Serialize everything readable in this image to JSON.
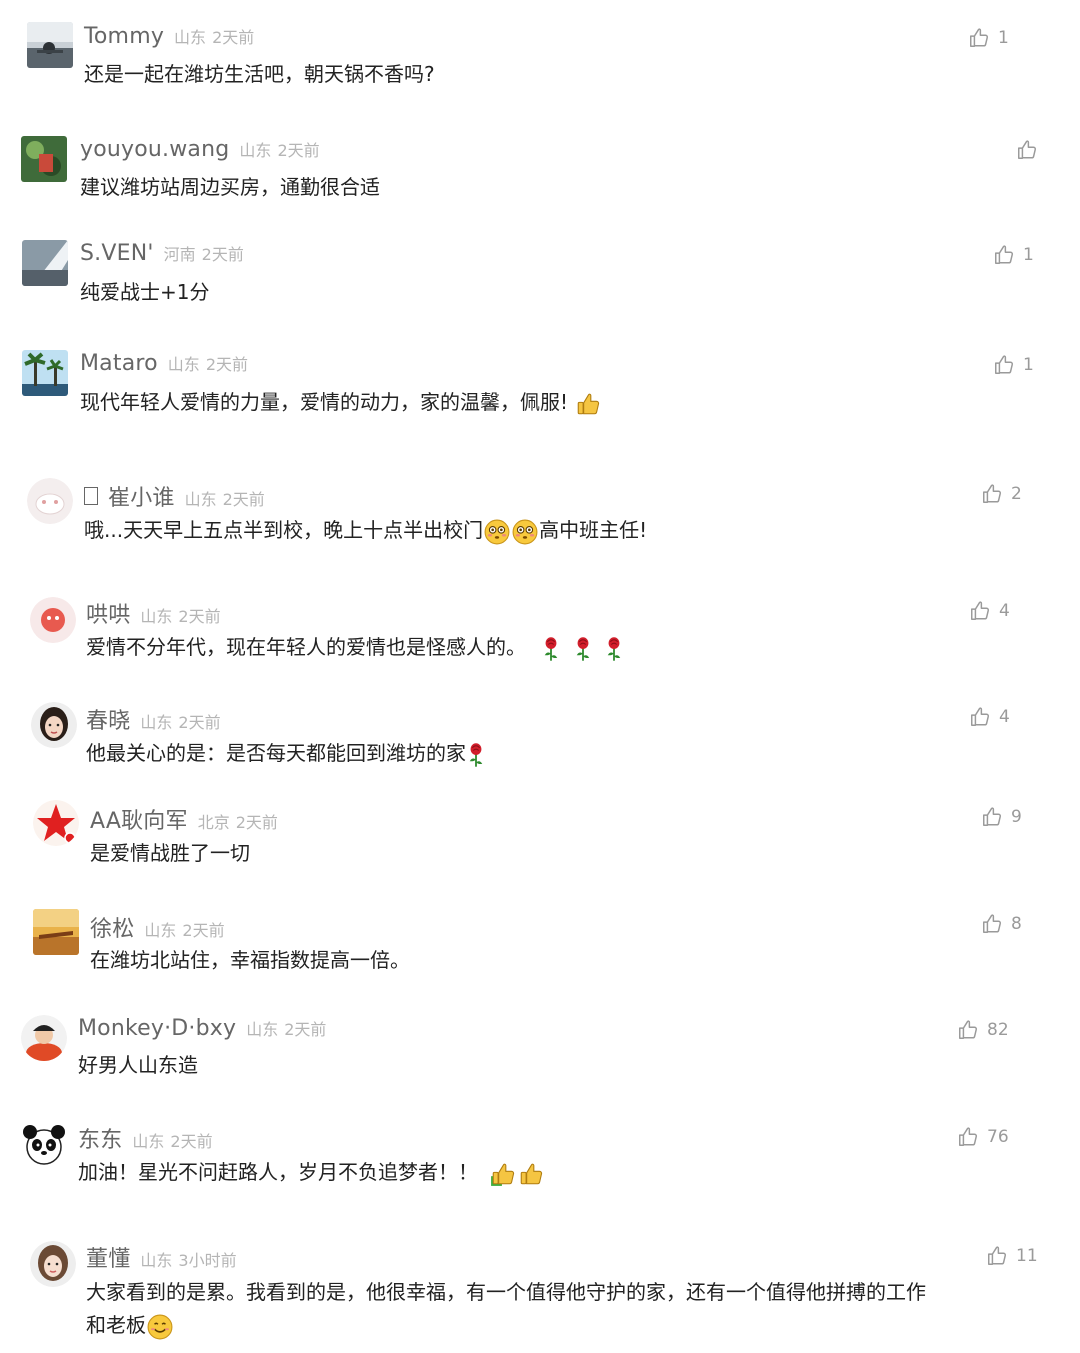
{
  "comments": [
    {
      "user": "Tommy",
      "location": "山东",
      "time": "2天前",
      "text": "还是一起在潍坊生活吧，朝天锅不香吗?",
      "likes": "1"
    },
    {
      "user": "youyou.wang",
      "location": "山东",
      "time": "2天前",
      "text": "建议潍坊站周边买房，通勤很合适",
      "likes": ""
    },
    {
      "user": "S.VEN'",
      "location": "河南",
      "time": "2天前",
      "text": "纯爱战士+1分",
      "likes": "1"
    },
    {
      "user": "Mataro",
      "location": "山东",
      "time": "2天前",
      "text": "现代年轻人爱情的力量，爱情的动力，家的温馨，佩服!",
      "likes": "1"
    },
    {
      "user": "崔小谁",
      "location": "山东",
      "time": "2天前",
      "text_a": "哦...天天早上五点半到校，晚上十点半出校门",
      "text_b": "高中班主任!",
      "likes": "2"
    },
    {
      "user": "哄哄",
      "location": "山东",
      "time": "2天前",
      "text": "爱情不分年代，现在年轻人的爱情也是怪感人的。",
      "likes": "4"
    },
    {
      "user": "春晓",
      "location": "山东",
      "time": "2天前",
      "text": "他最关心的是：是否每天都能回到潍坊的家",
      "likes": "4"
    },
    {
      "user": "AA耿向军",
      "location": "北京",
      "time": "2天前",
      "text": "是爱情战胜了一切",
      "likes": "9"
    },
    {
      "user": "徐松",
      "location": "山东",
      "time": "2天前",
      "text": "在潍坊北站住，幸福指数提高一倍。",
      "likes": "8"
    },
    {
      "user": "Monkey·D·bxy",
      "location": "山东",
      "time": "2天前",
      "text": "好男人山东造",
      "likes": "82"
    },
    {
      "user": "东东",
      "location": "山东",
      "time": "2天前",
      "text": "加油！星光不问赶路人，岁月不负追梦者！！",
      "likes": "76"
    },
    {
      "user": "董懂",
      "location": "山东",
      "time": "3小时前",
      "text_l1": "大家看到的是累。我看到的是，他很幸福，有一个值得他守护的家，还有一个值得他拼搏的工作",
      "text_l2": "和老板",
      "likes": "11"
    }
  ],
  "icons": {
    "like": "thumbs-up-outline-icon",
    "emoji_thumb": "thumbs-up-emoji",
    "emoji_rose": "rose-emoji",
    "emoji_flushed": "flushed-face-emoji",
    "emoji_smile": "smiling-face-emoji"
  }
}
